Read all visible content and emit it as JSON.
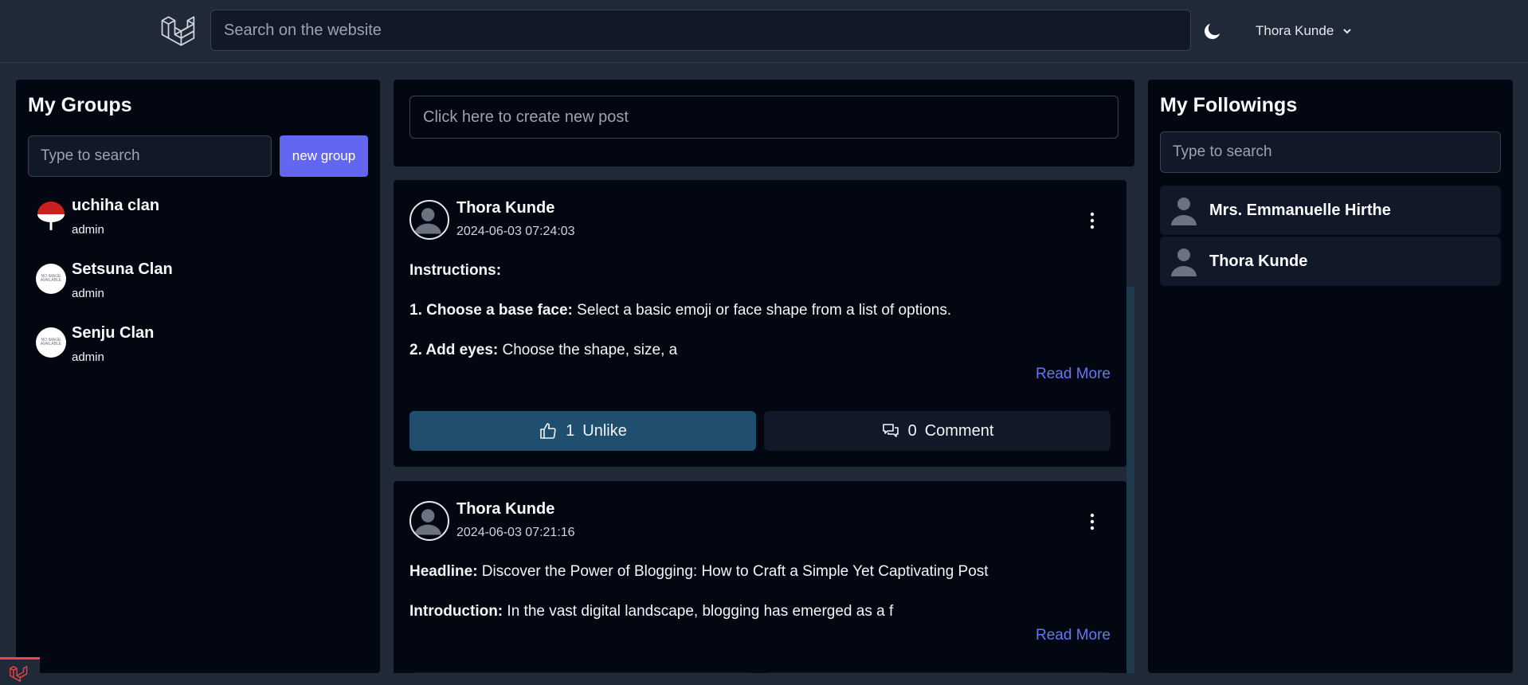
{
  "header": {
    "search_placeholder": "Search on the website",
    "user_name": "Thora Kunde",
    "logo_icon": "laravel-logo-icon",
    "theme_icon": "moon-icon"
  },
  "groups_panel": {
    "title": "My Groups",
    "search_placeholder": "Type to search",
    "new_group_label": "new group",
    "groups": [
      {
        "name": "uchiha clan",
        "role": "admin",
        "avatar": "uchiha-fan-icon"
      },
      {
        "name": "Setsuna Clan",
        "role": "admin",
        "avatar_text": "NO IMAGE AVAILABLE"
      },
      {
        "name": "Senju Clan",
        "role": "admin",
        "avatar_text": "NO IMAGE AVAILABLE"
      }
    ]
  },
  "create_post": {
    "placeholder": "Click here to create new post"
  },
  "posts": [
    {
      "author": "Thora Kunde",
      "timestamp": "2024-06-03 07:24:03",
      "lines": [
        {
          "bold": "Instructions:",
          "text": ""
        },
        {
          "bold": "1. Choose a base face:",
          "text": " Select a basic emoji or face shape from a list of options."
        },
        {
          "bold": "2. Add eyes:",
          "text": " Choose the shape, size, a"
        }
      ],
      "read_more": "Read More",
      "likes": "1",
      "like_label": "Unlike",
      "comments": "0",
      "comment_label": "Comment"
    },
    {
      "author": "Thora Kunde",
      "timestamp": "2024-06-03 07:21:16",
      "lines": [
        {
          "bold": "Headline:",
          "text": " Discover the Power of Blogging: How to Craft a Simple Yet Captivating Post"
        },
        {
          "bold": "Introduction:",
          "text": " In the vast digital landscape, blogging has emerged as a f"
        }
      ],
      "read_more": "Read More"
    }
  ],
  "followings_panel": {
    "title": "My Followings",
    "search_placeholder": "Type to search",
    "users": [
      {
        "name": "Mrs. Emmanuelle Hirthe"
      },
      {
        "name": "Thora Kunde"
      }
    ]
  },
  "colors": {
    "accent": "#6366f1",
    "like_button": "#1f4e6f",
    "link": "#6477f5",
    "background": "#1f2937",
    "panel": "#030712"
  }
}
